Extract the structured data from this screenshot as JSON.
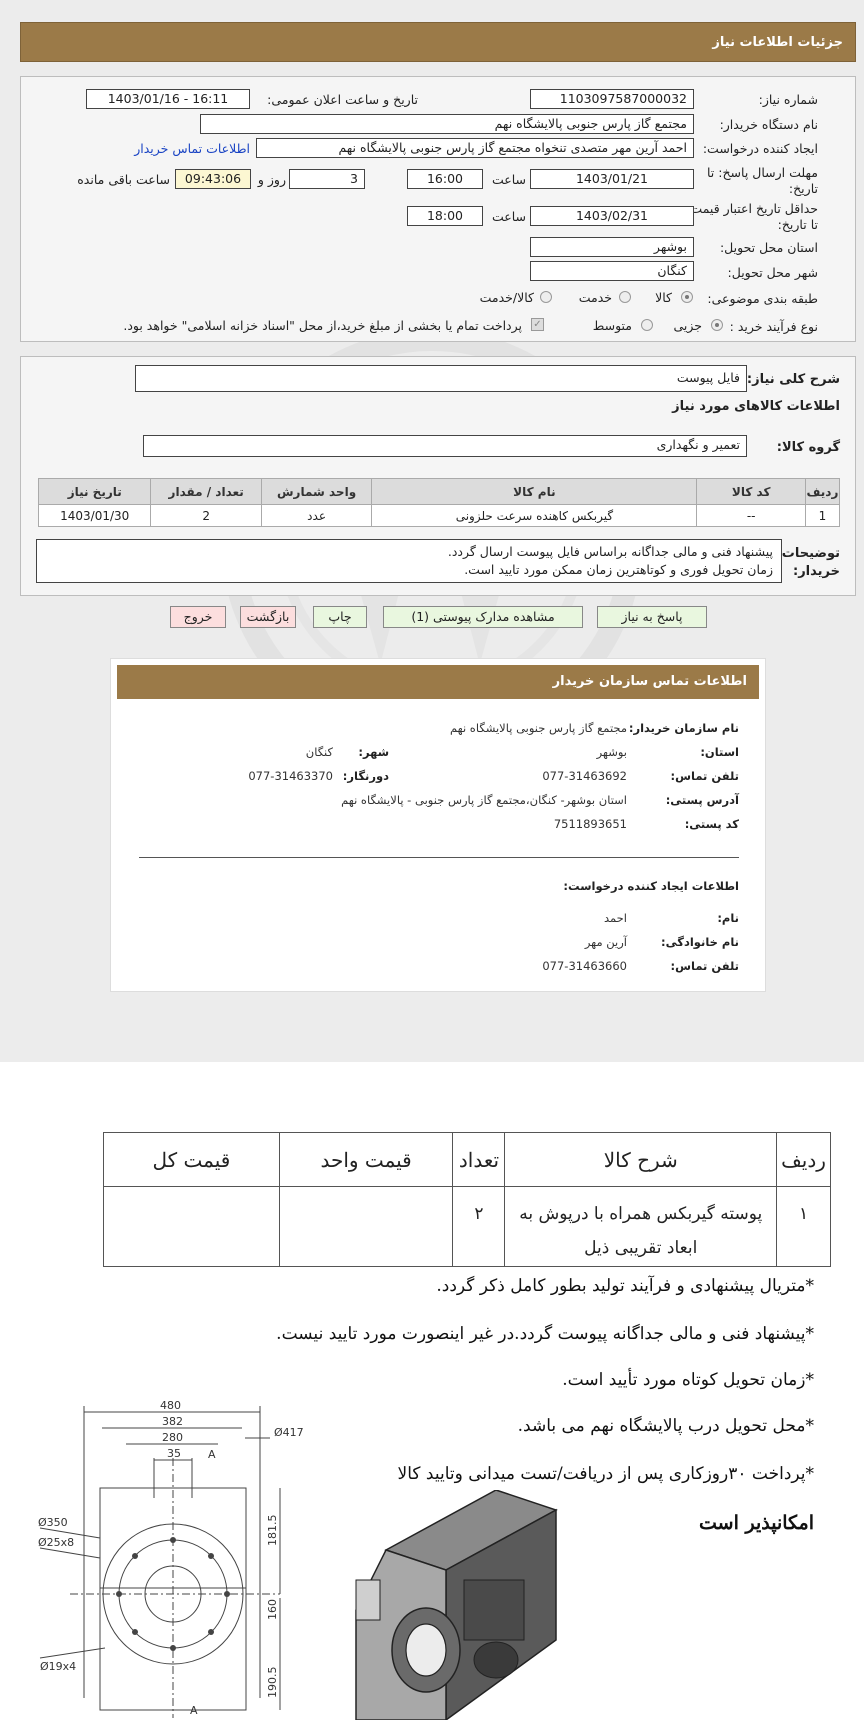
{
  "page": {
    "title": "جزئیات اطلاعات نیاز"
  },
  "form": {
    "need_number_label": "شماره نیاز:",
    "need_number": "1103097587000032",
    "announce_label": "تاریخ و ساعت اعلان عمومی:",
    "announce_value": "1403/01/16 - 16:11",
    "buyer_org_label": "نام دستگاه خریدار:",
    "buyer_org": "مجتمع گاز پارس جنوبی  پالایشگاه نهم",
    "requester_label": "ایجاد کننده درخواست:",
    "requester": "احمد آرین مهر متصدی تنخواه مجتمع گاز پارس جنوبی  پالایشگاه نهم",
    "buyer_contact_link": "اطلاعات تماس خریدار",
    "deadline_label": "مهلت ارسال پاسخ: تا تاریخ:",
    "deadline_date": "1403/01/21",
    "time_label": "ساعت",
    "deadline_time": "16:00",
    "days_value": "3",
    "days_label": "روز و",
    "remaining_time": "09:43:06",
    "remaining_label": "ساعت باقی مانده",
    "validity_label": "حداقل تاریخ اعتبار قیمت: تا تاریخ:",
    "validity_date": "1403/02/31",
    "validity_time": "18:00",
    "province_label": "استان محل تحویل:",
    "province": "بوشهر",
    "city_label": "شهر محل تحویل:",
    "city": "کنگان",
    "category_label": "طبقه بندی موضوعی:",
    "category_options": [
      "کالا",
      "خدمت",
      "کالا/خدمت"
    ],
    "category_selected": "کالا",
    "process_label": "نوع فرآیند خرید :",
    "process_options": [
      "جزیی",
      "متوسط"
    ],
    "process_selected": "جزیی",
    "payment_note": "پرداخت تمام یا بخشی از مبلغ خرید،از محل \"اسناد خزانه اسلامی\" خواهد بود."
  },
  "summary": {
    "general_desc_label": "شرح کلی نیاز:",
    "general_desc": "فایل پیوست",
    "items_heading": "اطلاعات کالاهای مورد نیاز",
    "group_label": "گروه کالا:",
    "group_value": "تعمیر و نگهداری"
  },
  "items_table": {
    "headers": [
      "ردیف",
      "کد کالا",
      "نام کالا",
      "واحد شمارش",
      "تعداد / مقدار",
      "تاریخ نیاز"
    ],
    "rows": [
      [
        "1",
        "--",
        "گیربکس کاهنده سرعت حلزونی",
        "عدد",
        "2",
        "1403/01/30"
      ]
    ]
  },
  "buyer_notes": {
    "label_1": "توضیحات",
    "label_2": "خریدار:",
    "line_1": "پیشنهاد فنی و مالی جداگانه براساس فایل پیوست ارسال گردد.",
    "line_2": "زمان تحویل فوری و کوتاهترین زمان ممکن مورد تایید است."
  },
  "buttons": {
    "reply": "پاسخ به نیاز",
    "attachments": "مشاهده مدارک پیوستی (1)",
    "print": "چاپ",
    "back": "بازگشت",
    "exit": "خروج"
  },
  "contact": {
    "header": "اطلاعات تماس سازمان خریدار",
    "org_label": "نام سازمان خریدار:",
    "org": "مجتمع گاز پارس جنوبی  پالایشگاه نهم",
    "province_label": "استان:",
    "province": "بوشهر",
    "city_label": "شهر:",
    "city": "کنگان",
    "phone_label": "تلفن تماس:",
    "phone": "077-31463692",
    "fax_label": "دورنگار:",
    "fax": "077-31463370",
    "address_label": "آدرس پستی:",
    "address": "استان بوشهر- کنگان،مجتمع گاز پارس جنوبی - پالایشگاه نهم",
    "postal_label": "کد پستی:",
    "postal": "7511893651",
    "requester_heading": "اطلاعات ایجاد کننده درخواست:",
    "name_label": "نام:",
    "name": "احمد",
    "family_label": "نام خانوادگی:",
    "family": "آرین مهر",
    "req_phone_label": "تلفن تماس:",
    "req_phone": "077-31463660"
  },
  "attachment_doc": {
    "headers": [
      "ردیف",
      "شرح کالا",
      "تعداد",
      "قیمت واحد",
      "قیمت کل"
    ],
    "rows": [
      [
        "١",
        "پوسته گیربکس همراه با درپوش به ابعاد تقریبی ذیل",
        "٢",
        "",
        ""
      ]
    ],
    "notes": [
      "*متریال پیشنهادی و فرآیند تولید بطور کامل ذکر گردد.",
      "*پیشنهاد فنی و مالی جداگانه پیوست گردد.در غیر اینصورت مورد تایید نیست.",
      "*زمان تحویل کوتاه مورد تأیید است.",
      "*محل تحویل درب پالایشگاه نهم می باشد.",
      "*پرداخت ۳۰روزکاری پس از دریافت/تست میدانی وتایید کالا",
      "امکانپذیر است"
    ],
    "drawing_dims": [
      "480",
      "382",
      "280",
      "35",
      "A",
      "Ø417",
      "Ø350",
      "Ø25x8",
      "Ø19x4",
      "181.5",
      "160",
      "190.5"
    ]
  }
}
